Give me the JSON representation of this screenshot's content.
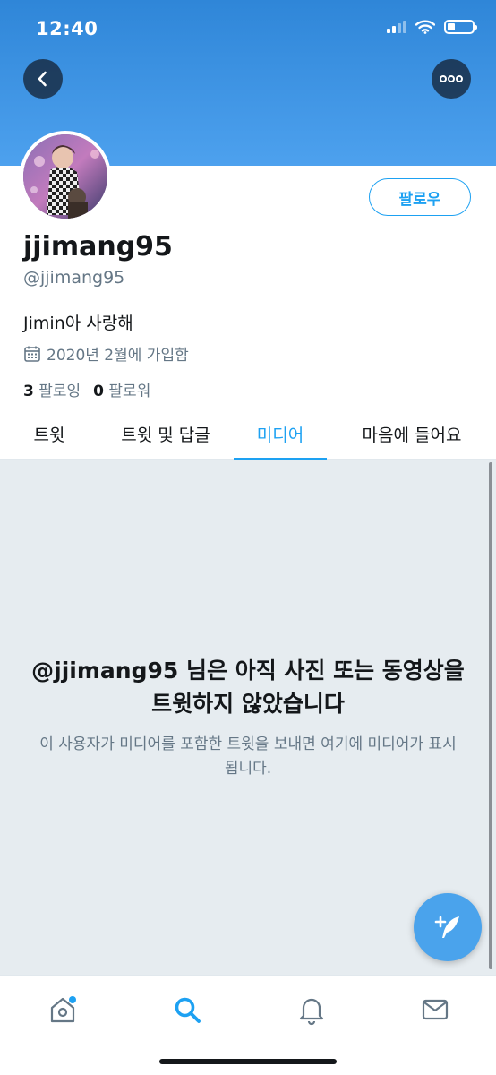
{
  "status_bar": {
    "time": "12:40"
  },
  "profile": {
    "display_name": "jjimang95",
    "handle": "@jjimang95",
    "bio": "Jimin아 사랑해",
    "joined": "2020년 2월에 가입함",
    "following_count": "3",
    "following_label": "팔로잉",
    "followers_count": "0",
    "followers_label": "팔로워",
    "follow_label": "팔로우"
  },
  "tabs": [
    {
      "label": "트윗",
      "active": false
    },
    {
      "label": "트윗 및 답글",
      "active": false
    },
    {
      "label": "미디어",
      "active": true
    },
    {
      "label": "마음에 들어요",
      "active": false
    }
  ],
  "empty_state": {
    "title": "@jjimang95 님은 아직 사진 또는 동영상을 트윗하지 않았습니다",
    "subtitle": "이 사용자가 미디어를 포함한 트윗을 보내면 여기에 미디어가 표시됩니다."
  },
  "colors": {
    "accent": "#1da1f2",
    "header_top": "#2f86d8",
    "header_bottom": "#4da1ee",
    "fab": "#4aa3ec",
    "empty_background": "#e6ecf0"
  },
  "icons": {
    "back": "chevron-left-icon",
    "more": "more-horizontal-icon",
    "calendar": "calendar-icon",
    "compose": "compose-feather-icon",
    "home": "home-icon",
    "search": "search-icon",
    "notifications": "bell-icon",
    "messages": "mail-icon"
  }
}
